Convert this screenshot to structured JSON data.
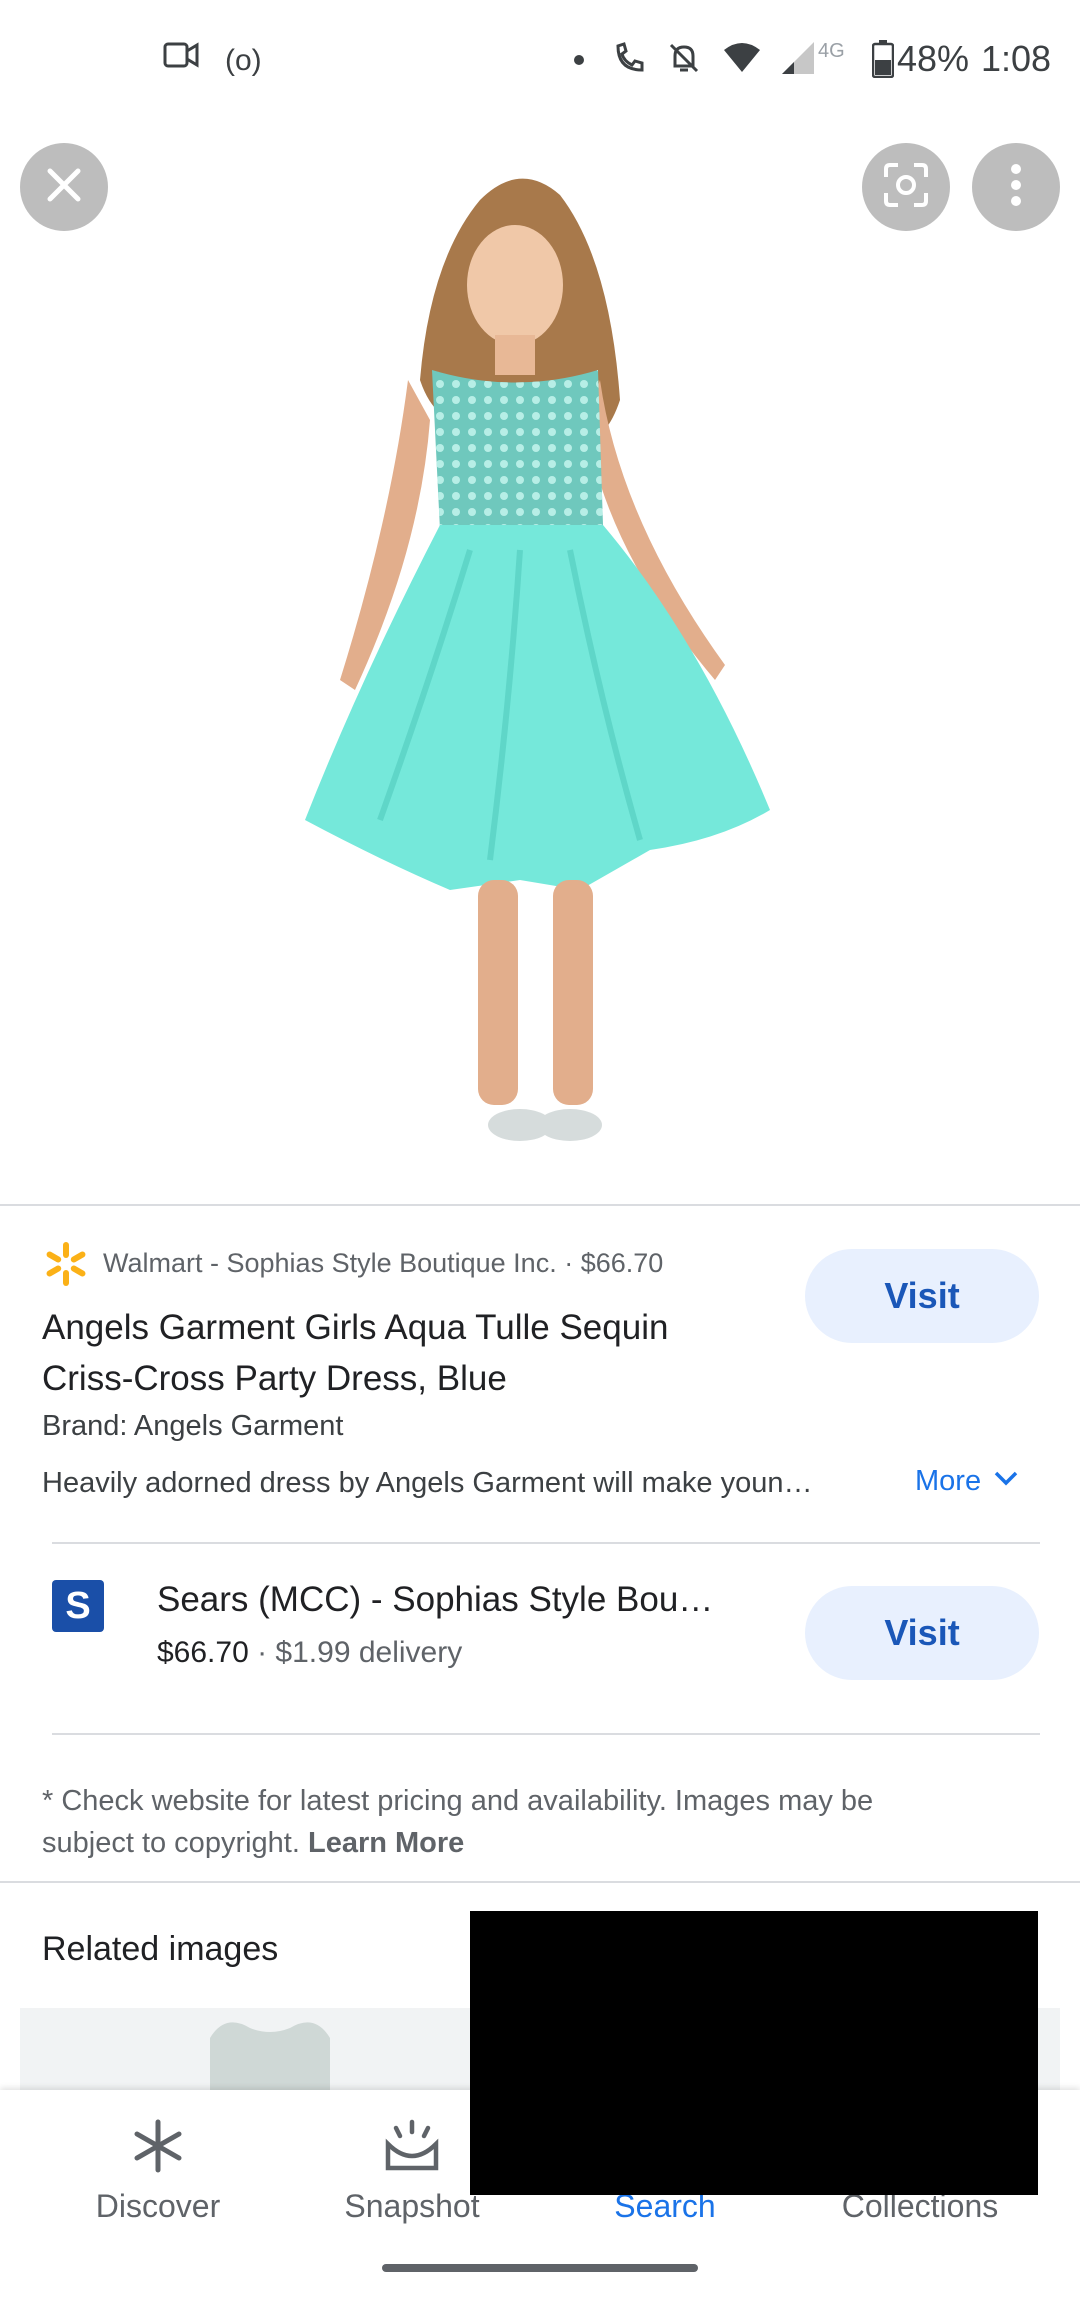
{
  "status_bar": {
    "cast_label": "(o)",
    "network": "4G",
    "battery": "48%",
    "time": "1:08"
  },
  "product": {
    "store_line": "Walmart - Sophias Style Boutique Inc. · $66.70",
    "title_line1": "Angels Garment Girls Aqua Tulle Sequin",
    "title_line2": "Criss-Cross Party Dress, Blue",
    "brand": "Brand: Angels Garment",
    "description": "Heavily adorned dress by Angels Garment will make youn…",
    "more_label": "More",
    "visit_label": "Visit"
  },
  "offer": {
    "store_initial": "S",
    "name": "Sears (MCC) - Sophias Style Bou…",
    "price": "$66.70",
    "delivery": "· $1.99 delivery",
    "visit_label": "Visit"
  },
  "disclaimer": {
    "line1": "* Check website for latest pricing and availability. Images may be",
    "line2_prefix": "subject to copyright.",
    "learn_more": "Learn More"
  },
  "related": {
    "heading": "Related images"
  },
  "bottom_nav": {
    "items": [
      {
        "label": "Discover",
        "icon": "asterisk-icon"
      },
      {
        "label": "Snapshot",
        "icon": "snapshot-icon"
      },
      {
        "label": "Search",
        "icon": "search-icon"
      },
      {
        "label": "Collections",
        "icon": "collections-icon"
      }
    ],
    "active_color": "#1a73e8"
  }
}
